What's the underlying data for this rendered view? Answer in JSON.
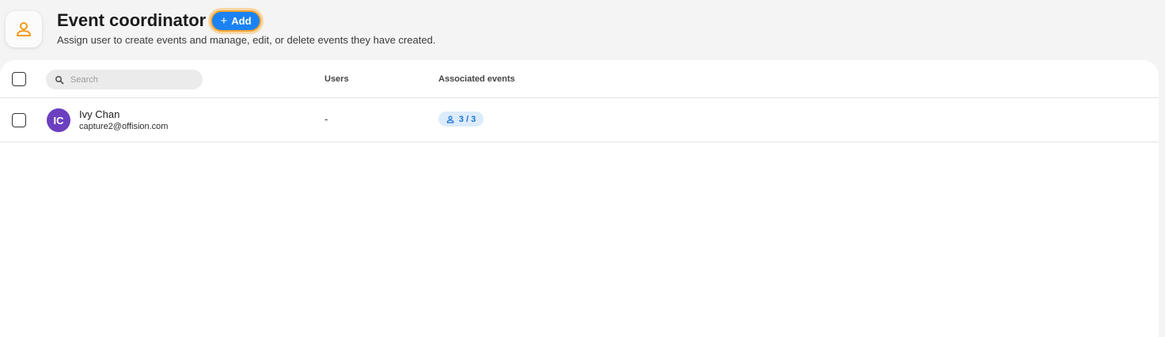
{
  "header": {
    "title": "Event coordinator",
    "add_label": "Add",
    "add_icon": "plus-icon",
    "subtitle": "Assign user to create events and manage, edit, or delete events they have created.",
    "role_icon": "person-icon",
    "role_icon_color": "#f29a1a"
  },
  "table": {
    "search_placeholder": "Search",
    "columns": {
      "users": "Users",
      "associated_events": "Associated events"
    },
    "rows": [
      {
        "initials": "IC",
        "name": "Ivy Chan",
        "email": "capture2@offision.com",
        "users": "-",
        "associated_events": "3 / 3",
        "avatar_color": "#6b3fc0"
      }
    ]
  },
  "colors": {
    "accent": "#1a82f2",
    "focus_ring": "#f3a430",
    "badge_bg": "#dcecfc",
    "badge_text": "#1a72d8"
  }
}
